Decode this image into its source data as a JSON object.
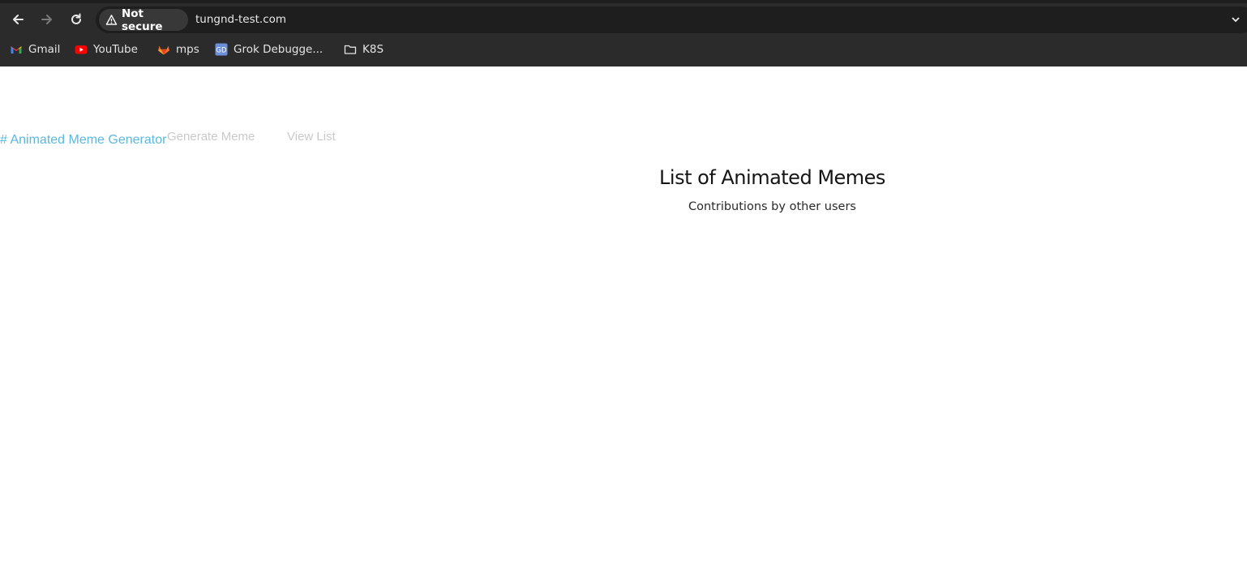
{
  "browser": {
    "security_label": "Not secure",
    "url": "tungnd-test.com",
    "bookmarks": [
      {
        "label": "Gmail",
        "icon": "gmail-icon"
      },
      {
        "label": "YouTube",
        "icon": "youtube-icon"
      },
      {
        "label": "mps",
        "icon": "gitlab-icon"
      },
      {
        "label": "Grok Debugge...",
        "icon": "grok-debugger-icon"
      },
      {
        "label": "K8S",
        "icon": "folder-icon"
      }
    ]
  },
  "site": {
    "brand": "# Animated Meme Generator",
    "nav": {
      "generate": "Generate Meme",
      "view_list": "View List"
    },
    "colors": {
      "brand": "#5bb8e0",
      "nav_link": "#c9c9c9"
    }
  },
  "main": {
    "title": "List of Animated Memes",
    "subtitle": "Contributions by other users"
  }
}
